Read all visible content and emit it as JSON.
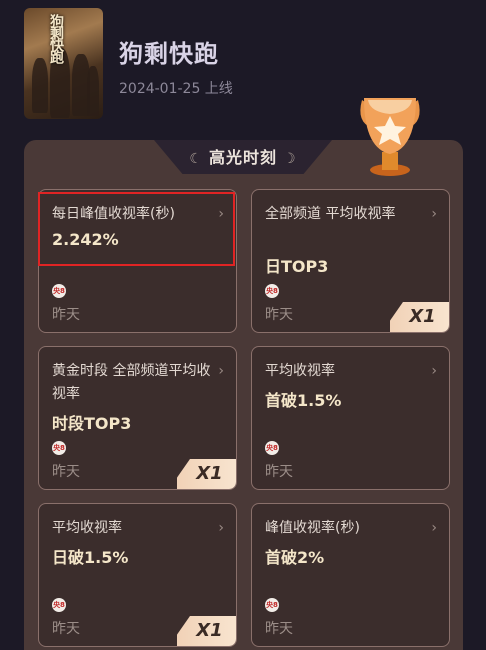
{
  "show": {
    "poster_text": "狗剩快跑",
    "title": "狗剩快跑",
    "release_line": "2024-01-25 上线"
  },
  "section": {
    "title": "高光时刻",
    "ornament_left": "☾",
    "ornament_right": "☽"
  },
  "cards": [
    {
      "title": "每日峰值收视率(秒)",
      "value": "2.242%",
      "channel": "央8",
      "when": "昨天",
      "badge": ""
    },
    {
      "title": "全部频道 平均收视率",
      "value": "日TOP3",
      "channel": "央8",
      "when": "昨天",
      "badge": "X1"
    },
    {
      "title": "黄金时段 全部频道平均收视率",
      "value": "时段TOP3",
      "channel": "央8",
      "when": "昨天",
      "badge": "X1"
    },
    {
      "title": "平均收视率",
      "value": "首破1.5%",
      "channel": "央8",
      "when": "昨天",
      "badge": ""
    },
    {
      "title": "平均收视率",
      "value": "日破1.5%",
      "channel": "央8",
      "when": "昨天",
      "badge": "X1"
    },
    {
      "title": "峰值收视率(秒)",
      "value": "首破2%",
      "channel": "央8",
      "when": "昨天",
      "badge": ""
    }
  ],
  "icons": {
    "chevron": "›",
    "trophy": "trophy-icon"
  },
  "colors": {
    "accent": "#f4e6c9",
    "panel": "#4a3937",
    "focus": "#e02424"
  }
}
